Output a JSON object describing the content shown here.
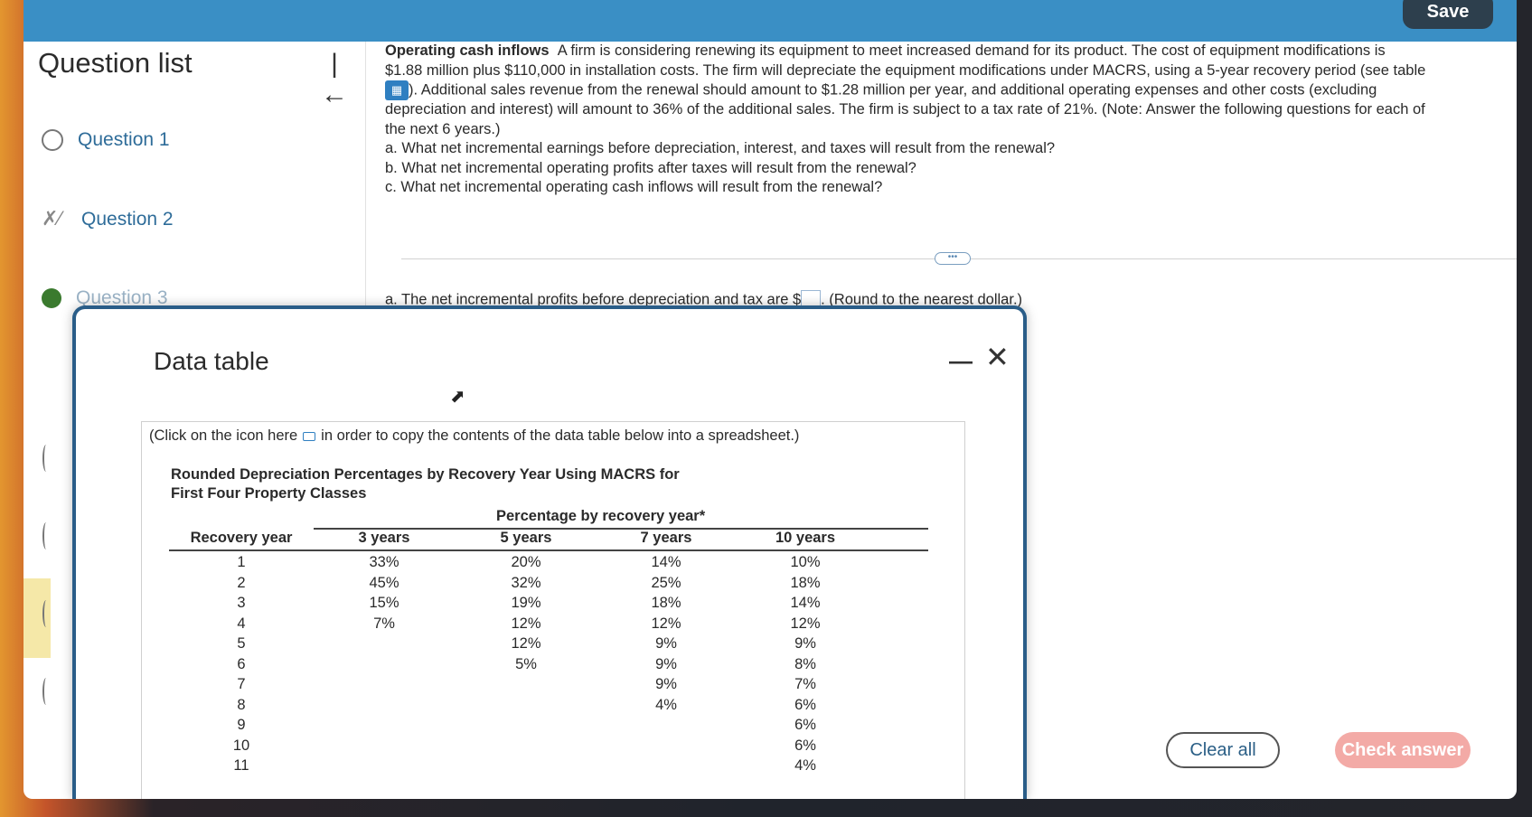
{
  "toolbar": {
    "save_label": "Save"
  },
  "sidebar": {
    "title": "Question list",
    "items": [
      {
        "label": "Question 1"
      },
      {
        "label": "Question 2"
      },
      {
        "label": "Question 3"
      }
    ]
  },
  "question": {
    "title": "Operating cash inflows",
    "line1": "A firm is considering renewing its equipment to meet increased demand for its product. The cost of equipment modifications is",
    "line2": "$1.88 million plus $110,000 in installation costs. The firm will depreciate the equipment modifications under MACRS, using a 5-year recovery period (see table",
    "line3": "). Additional sales revenue from the renewal should amount to $1.28 million per year, and additional operating expenses and other costs (excluding",
    "line4": "depreciation and interest) will amount to 36% of the additional sales. The firm is subject to a tax rate of 21%. (Note: Answer the following questions for each of",
    "line5": "the next 6 years.)",
    "part_a": "a. What net incremental earnings before depreciation, interest, and taxes will result from the renewal?",
    "part_b": "b. What net incremental operating profits after taxes will result from the renewal?",
    "part_c": "c. What net incremental operating cash inflows will result from the renewal?"
  },
  "answer": {
    "prefix": "a. The net incremental profits before depreciation and tax are $",
    "suffix": ". (Round to the nearest dollar.)"
  },
  "buttons": {
    "clear": "Clear all",
    "check": "Check answer"
  },
  "modal": {
    "title": "Data table",
    "copy_note_before": "(Click on the icon here",
    "copy_note_after": "in order to copy the contents of the data table below into a spreadsheet.)",
    "caption_line1": "Rounded Depreciation Percentages by Recovery Year Using MACRS for",
    "caption_line2": "First Four Property Classes",
    "group_header": "Percentage by recovery year*",
    "columns": [
      "Recovery year",
      "3 years",
      "5 years",
      "7 years",
      "10 years"
    ],
    "rows": [
      [
        "1",
        "33%",
        "20%",
        "14%",
        "10%"
      ],
      [
        "2",
        "45%",
        "32%",
        "25%",
        "18%"
      ],
      [
        "3",
        "15%",
        "19%",
        "18%",
        "14%"
      ],
      [
        "4",
        "7%",
        "12%",
        "12%",
        "12%"
      ],
      [
        "5",
        "",
        "12%",
        "9%",
        "9%"
      ],
      [
        "6",
        "",
        "5%",
        "9%",
        "8%"
      ],
      [
        "7",
        "",
        "",
        "9%",
        "7%"
      ],
      [
        "8",
        "",
        "",
        "4%",
        "6%"
      ],
      [
        "9",
        "",
        "",
        "",
        "6%"
      ],
      [
        "10",
        "",
        "",
        "",
        "6%"
      ],
      [
        "11",
        "",
        "",
        "",
        "4%"
      ]
    ]
  }
}
